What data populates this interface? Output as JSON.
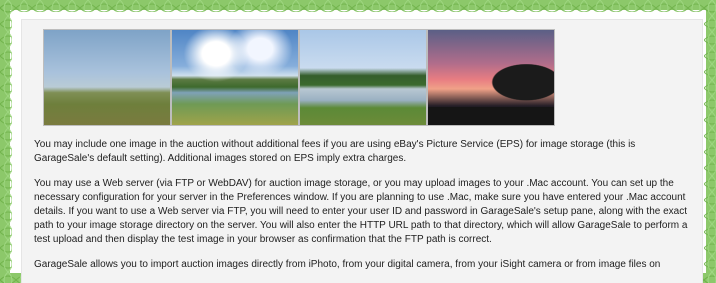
{
  "images": [
    {
      "alt": "photo-1"
    },
    {
      "alt": "photo-2"
    },
    {
      "alt": "photo-3"
    },
    {
      "alt": "photo-4"
    }
  ],
  "paragraphs": [
    "You may include one image in the auction without additional fees if you are using eBay's Picture Service (EPS) for image storage (this is GarageSale's default setting). Additional images stored on EPS imply extra charges.",
    "You may use a Web server (via FTP or WebDAV) for auction image storage, or you may upload images to your .Mac account. You can set up the necessary configuration for your server in the Preferences window. If you are planning to use .Mac, make sure you have entered your .Mac account details. If you want to use a Web server via FTP, you will need to enter your user ID and password in GarageSale's setup pane, along with the exact path to your image storage directory on the server. You will also enter the HTTP URL path to that directory, which will allow GarageSale to perform a test upload and then display the test image in your browser as confirmation that the FTP path is correct.",
    "GarageSale allows you to import auction images directly from iPhoto, from your digital camera, from your iSight camera or from image files on"
  ],
  "colors": {
    "border_green": "#8cc86a",
    "content_bg": "#f3f3f3",
    "text": "#1e1e1e"
  }
}
